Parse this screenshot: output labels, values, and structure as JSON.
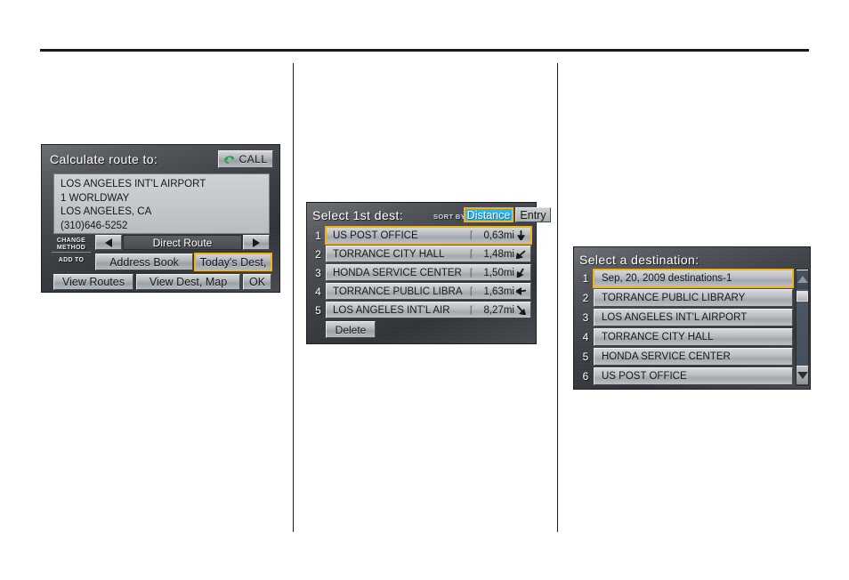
{
  "left_screen": {
    "title": "Calculate route to:",
    "call_button": {
      "label": "CALL",
      "icon": "phone-icon",
      "color": "#1f9d55"
    },
    "address": {
      "line1": "LOS ANGELES INT'L AIRPORT",
      "line2": "1 WORLDWAY",
      "line3": "LOS ANGELES, CA",
      "line4": "(310)646-5252"
    },
    "change_method_label": "CHANGE METHOD",
    "add_to_label": "ADD TO",
    "route_mode": "Direct Route",
    "prev_icon": "triangle-left-icon",
    "next_icon": "triangle-right-icon",
    "address_book_button": "Address Book",
    "todays_dest_button": "Today's Dest,",
    "view_routes_button": "View Routes",
    "view_dest_map_button": "View Dest, Map",
    "ok_button": "OK",
    "selected_button": "Today's Dest,"
  },
  "middle_screen": {
    "title": "Select 1st dest:",
    "sort_by_label": "SORT BY",
    "sort_tabs": [
      {
        "label": "Distance",
        "active": true
      },
      {
        "label": "Entry",
        "active": false
      }
    ],
    "active_sort_color": "#2fb4f0",
    "bracket_glyph": "⌈",
    "rows": [
      {
        "index": "1",
        "name": "US POST OFFICE",
        "distance": "0,63mi",
        "direction": "arrow-south-icon",
        "selected": true
      },
      {
        "index": "2",
        "name": "TORRANCE CITY HALL",
        "distance": "1,48mi",
        "direction": "arrow-southwest-icon",
        "selected": false
      },
      {
        "index": "3",
        "name": "HONDA SERVICE CENTER",
        "distance": "1,50mi",
        "direction": "arrow-south-southwest-icon",
        "selected": false
      },
      {
        "index": "4",
        "name": "TORRANCE PUBLIC LIBRA",
        "distance": "1,63mi",
        "direction": "arrow-west-icon",
        "selected": false
      },
      {
        "index": "5",
        "name": "LOS ANGELES INT'L AIR",
        "distance": "8,27mi",
        "direction": "arrow-southeast-icon",
        "selected": false
      }
    ],
    "delete_button": "Delete"
  },
  "right_screen": {
    "title": "Select a destination:",
    "rows": [
      {
        "index": "1",
        "name": "Sep, 20, 2009 destinations-1",
        "selected": true
      },
      {
        "index": "2",
        "name": "TORRANCE PUBLIC LIBRARY",
        "selected": false
      },
      {
        "index": "3",
        "name": "LOS ANGELES INT'L AIRPORT",
        "selected": false
      },
      {
        "index": "4",
        "name": "TORRANCE CITY HALL",
        "selected": false
      },
      {
        "index": "5",
        "name": "HONDA SERVICE CENTER",
        "selected": false
      },
      {
        "index": "6",
        "name": "US POST OFFICE",
        "selected": false
      }
    ],
    "scrollbar": {
      "up_icon": "triangle-up-icon",
      "down_icon": "triangle-down-icon"
    }
  },
  "theme": {
    "highlight_border": "#f2b21a",
    "screen_bg_dark": "#3e4247",
    "button_face": "#b7babd"
  }
}
